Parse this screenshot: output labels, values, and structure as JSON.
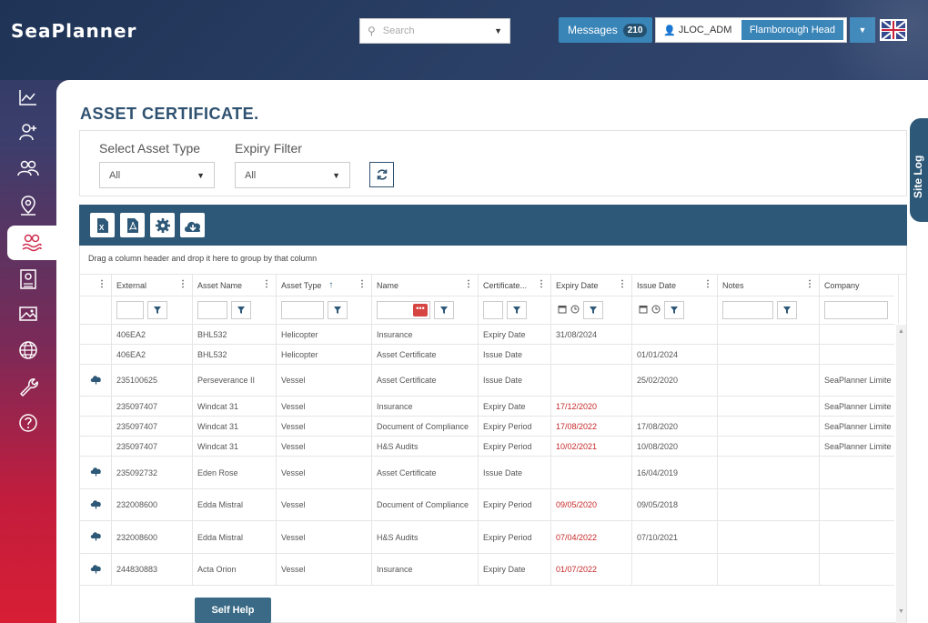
{
  "header": {
    "logo": "SeaPlanner",
    "search_placeholder": "Search",
    "messages_label": "Messages",
    "messages_count": "210",
    "username": "JLOC_ADM",
    "site": "Flamborough Head"
  },
  "sidebar": {
    "items": [
      {
        "icon": "chart-icon"
      },
      {
        "icon": "add-user-icon"
      },
      {
        "icon": "users-icon"
      },
      {
        "icon": "location-pin-icon"
      },
      {
        "icon": "certificate-icon",
        "active": true
      },
      {
        "icon": "id-card-icon"
      },
      {
        "icon": "image-icon"
      },
      {
        "icon": "globe-icon"
      },
      {
        "icon": "wrench-icon"
      },
      {
        "icon": "help-icon"
      }
    ]
  },
  "page": {
    "title": "ASSET CERTIFICATE."
  },
  "filters": {
    "asset_type_label": "Select Asset Type",
    "asset_type_value": "All",
    "expiry_label": "Expiry Filter",
    "expiry_value": "All"
  },
  "grid": {
    "group_hint": "Drag a column header and drop it here to group by that column",
    "columns": [
      "External",
      "Asset Name",
      "Asset Type",
      "Name",
      "Certificate...",
      "Expiry Date",
      "Issue Date",
      "Notes",
      "Company"
    ],
    "rows": [
      {
        "cloud": false,
        "external": "406EA2",
        "asset_name": "BHL532",
        "asset_type": "Helicopter",
        "name": "Insurance",
        "cert": "Expiry Date",
        "expiry": "31/08/2024",
        "expired": false,
        "issue": "",
        "notes": "",
        "company": ""
      },
      {
        "cloud": false,
        "external": "406EA2",
        "asset_name": "BHL532",
        "asset_type": "Helicopter",
        "name": "Asset Certificate",
        "cert": "Issue Date",
        "expiry": "",
        "expired": false,
        "issue": "01/01/2024",
        "notes": "",
        "company": ""
      },
      {
        "cloud": true,
        "external": "235100625",
        "asset_name": "Perseverance II",
        "asset_type": "Vessel",
        "name": "Asset Certificate",
        "cert": "Issue Date",
        "expiry": "",
        "expired": false,
        "issue": "25/02/2020",
        "notes": "",
        "company": "SeaPlanner Limite"
      },
      {
        "cloud": false,
        "external": "235097407",
        "asset_name": "Windcat 31",
        "asset_type": "Vessel",
        "name": "Insurance",
        "cert": "Expiry Date",
        "expiry": "17/12/2020",
        "expired": true,
        "issue": "",
        "notes": "",
        "company": "SeaPlanner Limite"
      },
      {
        "cloud": false,
        "external": "235097407",
        "asset_name": "Windcat 31",
        "asset_type": "Vessel",
        "name": "Document of Compliance",
        "cert": "Expiry Period",
        "expiry": "17/08/2022",
        "expired": true,
        "issue": "17/08/2020",
        "notes": "",
        "company": "SeaPlanner Limite"
      },
      {
        "cloud": false,
        "external": "235097407",
        "asset_name": "Windcat 31",
        "asset_type": "Vessel",
        "name": "H&S Audits",
        "cert": "Expiry Period",
        "expiry": "10/02/2021",
        "expired": true,
        "issue": "10/08/2020",
        "notes": "",
        "company": "SeaPlanner Limite"
      },
      {
        "cloud": true,
        "external": "235092732",
        "asset_name": "Eden Rose",
        "asset_type": "Vessel",
        "name": "Asset Certificate",
        "cert": "Issue Date",
        "expiry": "",
        "expired": false,
        "issue": "16/04/2019",
        "notes": "",
        "company": ""
      },
      {
        "cloud": true,
        "external": "232008600",
        "asset_name": "Edda Mistral",
        "asset_type": "Vessel",
        "name": "Document of Compliance",
        "cert": "Expiry Period",
        "expiry": "09/05/2020",
        "expired": true,
        "issue": "09/05/2018",
        "notes": "",
        "company": ""
      },
      {
        "cloud": true,
        "external": "232008600",
        "asset_name": "Edda Mistral",
        "asset_type": "Vessel",
        "name": "H&S Audits",
        "cert": "Expiry Period",
        "expiry": "07/04/2022",
        "expired": true,
        "issue": "07/10/2021",
        "notes": "",
        "company": ""
      },
      {
        "cloud": true,
        "external": "244830883",
        "asset_name": "Acta Orion",
        "asset_type": "Vessel",
        "name": "Insurance",
        "cert": "Expiry Date",
        "expiry": "01/07/2022",
        "expired": true,
        "issue": "",
        "notes": "",
        "company": ""
      }
    ]
  },
  "self_help_label": "Self Help",
  "site_log_label": "Site Log",
  "colors": {
    "primary": "#2e5877",
    "accent": "#3a85b8",
    "expired_text": "#c62828",
    "title": "#2e5170"
  }
}
